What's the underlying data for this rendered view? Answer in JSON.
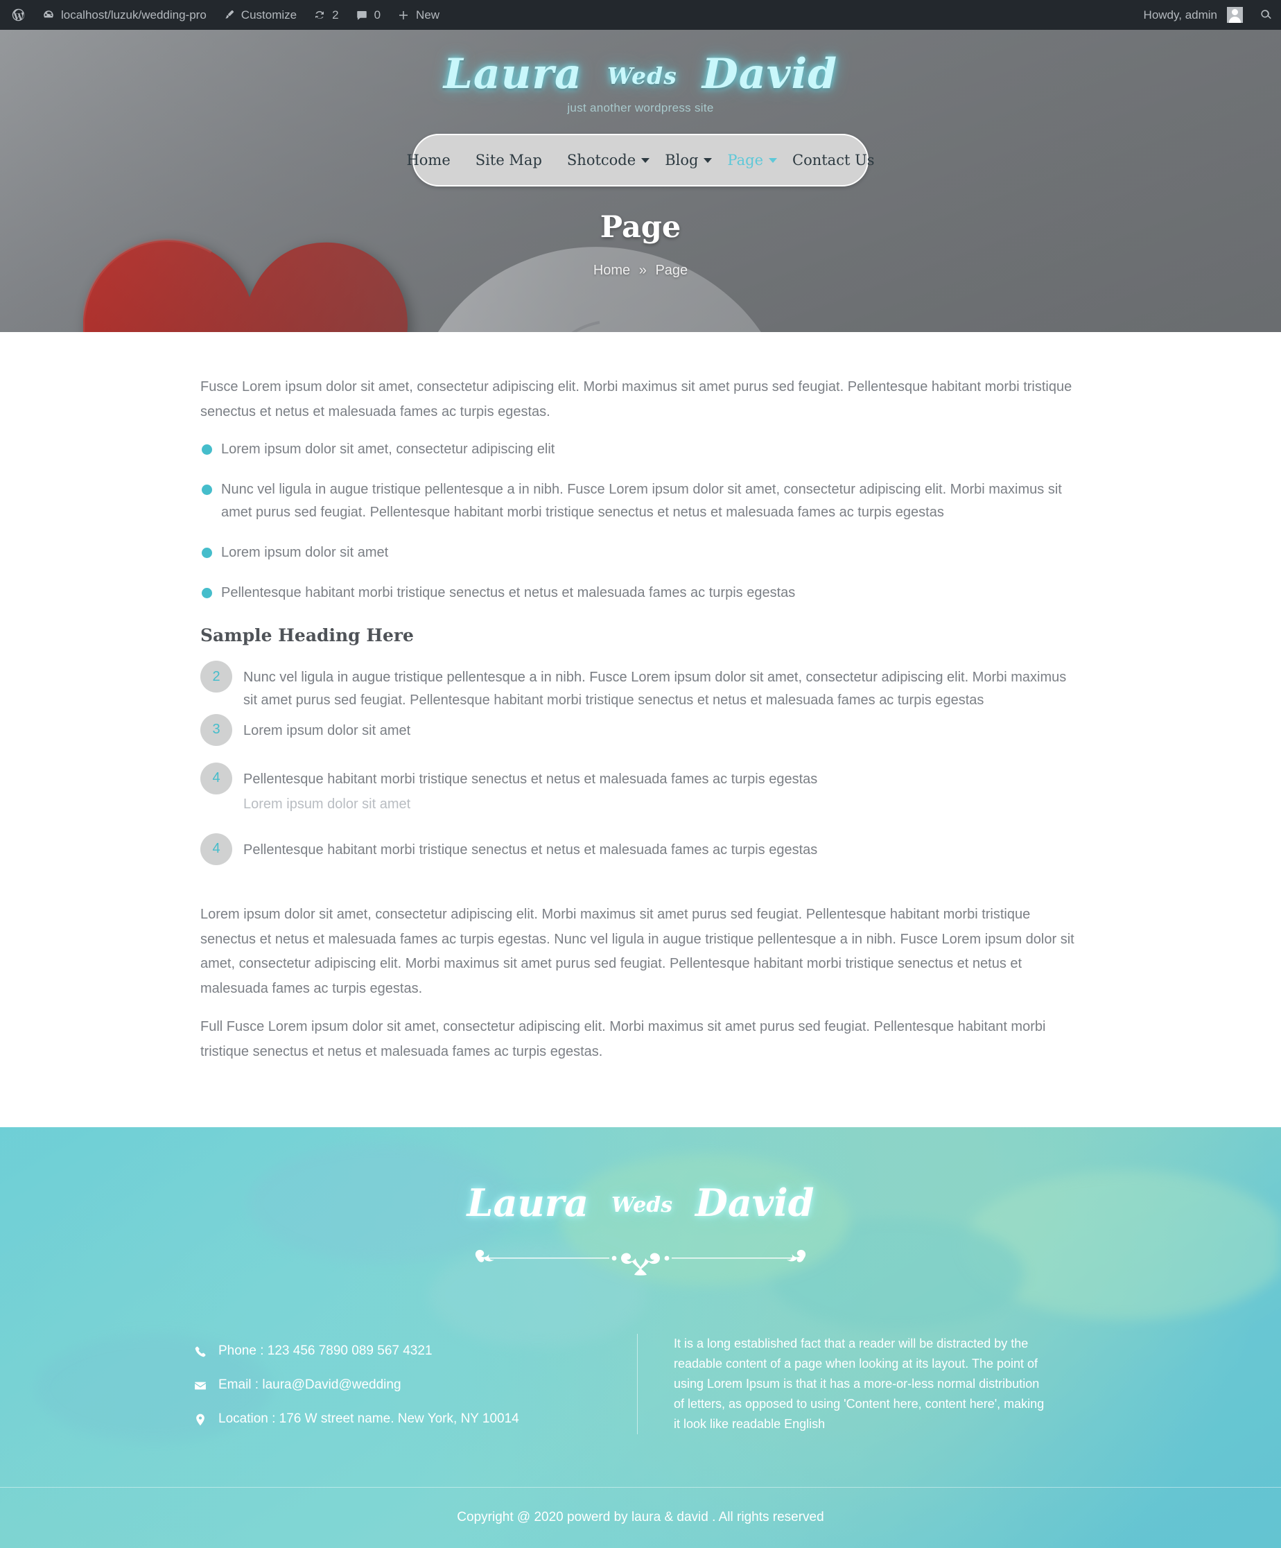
{
  "adminbar": {
    "wp_logo_icon": "wordpress-logo-icon",
    "site_icon": "dashboard-icon",
    "site_name": "localhost/luzuk/wedding-pro",
    "customize_icon": "paintbrush-icon",
    "customize_label": "Customize",
    "updates_icon": "updates-refresh-icon",
    "updates_count": "2",
    "comments_icon": "comment-bubble-icon",
    "comments_count": "0",
    "new_icon": "plus-icon",
    "new_label": "New",
    "howdy": "Howdy, admin",
    "avatar_icon": "user-avatar-icon",
    "search_icon": "search-icon"
  },
  "header": {
    "logo": {
      "first": "Laura",
      "weds": "Weds",
      "second": "David"
    },
    "tagline": "just another wordpress site",
    "nav": [
      {
        "label": "Home",
        "active": false,
        "has_caret": false
      },
      {
        "label": "Site Map",
        "active": false,
        "has_caret": false
      },
      {
        "label": "Shotcode",
        "active": false,
        "has_caret": true
      },
      {
        "label": "Blog",
        "active": false,
        "has_caret": true
      },
      {
        "label": "Page",
        "active": true,
        "has_caret": true
      },
      {
        "label": "Contact Us",
        "active": false,
        "has_caret": false
      }
    ]
  },
  "banner": {
    "title": "Page",
    "breadcrumb_home": "Home",
    "breadcrumb_sep": "»",
    "breadcrumb_current": "Page"
  },
  "main": {
    "intro": "Fusce Lorem ipsum dolor sit amet, consectetur adipiscing elit. Morbi maximus sit amet purus sed feugiat. Pellentesque habitant morbi tristique senectus et netus et malesuada fames ac turpis egestas.",
    "bullets": [
      "Lorem ipsum dolor sit amet, consectetur adipiscing elit",
      "Nunc vel ligula in augue tristique pellentesque a in nibh. Fusce Lorem ipsum dolor sit amet, consectetur adipiscing elit. Morbi maximus sit amet purus sed feugiat. Pellentesque habitant morbi tristique senectus et netus et malesuada fames ac turpis egestas",
      "Lorem ipsum dolor sit amet",
      "Pellentesque habitant morbi tristique senectus et netus et malesuada fames ac turpis egestas"
    ],
    "heading": "Sample Heading Here",
    "numbered": [
      {
        "num": "2",
        "text": "Nunc vel ligula in augue tristique pellentesque a in nibh. Fusce Lorem ipsum dolor sit amet, consectetur adipiscing elit. Morbi maximus sit amet purus sed feugiat. Pellentesque habitant morbi tristique senectus et netus et malesuada fames ac turpis egestas",
        "clipped_line": "Nunc vel ligula in augue tristique pellentesque a in nibh. Fusce Lorem ipsum dolor sit amet, consectetur adipiscing elit."
      },
      {
        "num": "3",
        "text": "Lorem ipsum dolor sit amet"
      },
      {
        "num": "4",
        "text": "Pellentesque habitant morbi tristique senectus et netus et malesuada fames ac turpis egestas",
        "overlap_text": "Lorem ipsum dolor sit amet"
      },
      {
        "num": "4",
        "text": "Pellentesque habitant morbi tristique senectus et netus et malesuada fames ac turpis egestas"
      }
    ],
    "para_2": "Lorem ipsum dolor sit amet, consectetur adipiscing elit. Morbi maximus sit amet purus sed feugiat. Pellentesque habitant morbi tristique senectus et netus et malesuada fames ac turpis egestas. Nunc vel ligula in augue tristique pellentesque a in nibh. Fusce Lorem ipsum dolor sit amet, consectetur adipiscing elit. Morbi maximus sit amet purus sed feugiat. Pellentesque habitant morbi tristique senectus et netus et malesuada fames ac turpis egestas.",
    "para_3": "Full Fusce Lorem ipsum dolor sit amet, consectetur adipiscing elit. Morbi maximus sit amet purus sed feugiat. Pellentesque habitant morbi tristique senectus et netus et malesuada fames ac turpis egestas."
  },
  "footer": {
    "logo": {
      "first": "Laura",
      "weds": "Weds",
      "second": "David"
    },
    "divider_icon": "ornamental-flourish-divider-icon",
    "phone_icon": "phone-icon",
    "phone": "Phone : 123 456 7890 089 567 4321",
    "email_icon": "envelope-icon",
    "email": "Email : laura@David@wedding",
    "location_icon": "map-pin-icon",
    "location": "Location : 176 W street name. New York, NY 10014",
    "about": "It is a long established fact that a reader will be distracted by the readable content of a page when looking at its layout. The point of using Lorem Ipsum is that it has a more-or-less normal distribution of letters, as opposed to using 'Content here, content here', making it look like readable English",
    "copyright": "Copyright @ 2020 powerd by laura & david . All rights reserved"
  },
  "colors": {
    "accent_cyan": "#45bdcb",
    "admin_bar": "#23282d",
    "nav_pill": "#d3d3d3",
    "body_text": "#7b7f85"
  }
}
